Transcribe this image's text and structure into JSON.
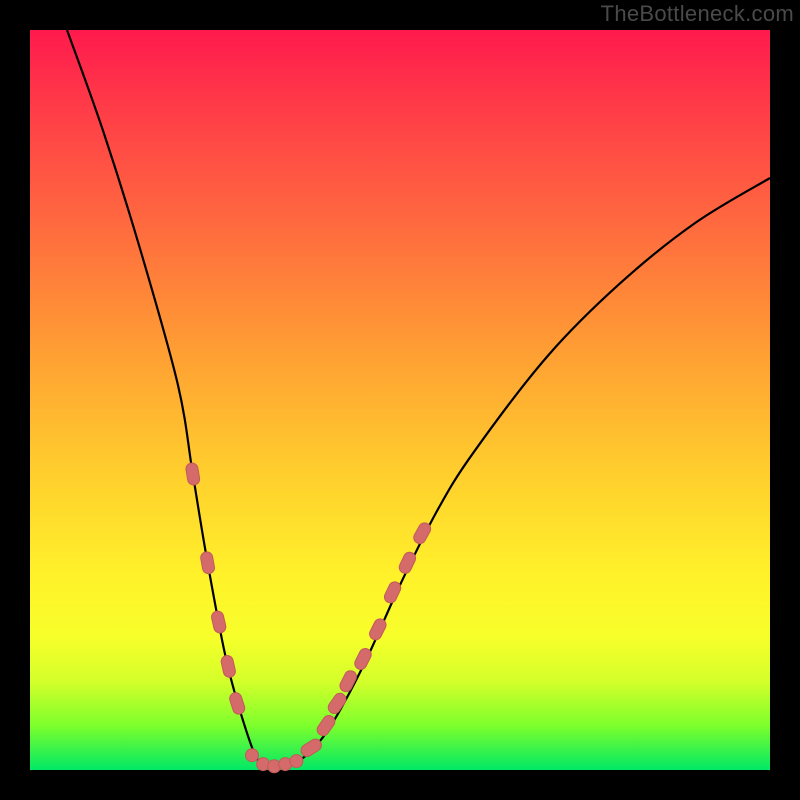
{
  "watermark": "TheBottleneck.com",
  "colors": {
    "marker_fill": "#d46a6a",
    "marker_stroke": "#c25a5a",
    "curve_stroke": "#000000",
    "frame": "#000000"
  },
  "chart_data": {
    "type": "line",
    "title": "",
    "xlabel": "",
    "ylabel": "",
    "xlim": [
      0,
      100
    ],
    "ylim": [
      0,
      100
    ],
    "series": [
      {
        "name": "bottleneck-curve",
        "x": [
          5,
          10,
          15,
          20,
          22,
          24,
          26.5,
          29,
          31,
          33,
          36,
          40,
          45,
          50,
          55,
          60,
          70,
          80,
          90,
          100
        ],
        "y": [
          100,
          86,
          70,
          52,
          40,
          28,
          15,
          6,
          1,
          0.5,
          1,
          5,
          14,
          25,
          35,
          43,
          56,
          66,
          74,
          80
        ]
      }
    ],
    "annotations": [
      {
        "name": "marker-seg-left-1",
        "x": 22,
        "y": 40,
        "kind": "pill"
      },
      {
        "name": "marker-seg-left-2",
        "x": 24,
        "y": 28,
        "kind": "pill"
      },
      {
        "name": "marker-seg-left-3",
        "x": 25.5,
        "y": 20,
        "kind": "pill"
      },
      {
        "name": "marker-seg-left-4",
        "x": 26.8,
        "y": 14,
        "kind": "pill"
      },
      {
        "name": "marker-seg-left-5",
        "x": 28,
        "y": 9,
        "kind": "pill"
      },
      {
        "name": "marker-floor-1",
        "x": 30,
        "y": 2,
        "kind": "dot"
      },
      {
        "name": "marker-floor-2",
        "x": 31.5,
        "y": 0.8,
        "kind": "dot"
      },
      {
        "name": "marker-floor-3",
        "x": 33,
        "y": 0.5,
        "kind": "dot"
      },
      {
        "name": "marker-floor-4",
        "x": 34.5,
        "y": 0.8,
        "kind": "dot"
      },
      {
        "name": "marker-floor-5",
        "x": 36,
        "y": 1.2,
        "kind": "dot"
      },
      {
        "name": "marker-seg-right-1",
        "x": 38,
        "y": 3,
        "kind": "pill"
      },
      {
        "name": "marker-seg-right-2",
        "x": 40,
        "y": 6,
        "kind": "pill"
      },
      {
        "name": "marker-seg-right-3",
        "x": 41.5,
        "y": 9,
        "kind": "pill"
      },
      {
        "name": "marker-seg-right-4",
        "x": 43,
        "y": 12,
        "kind": "pill"
      },
      {
        "name": "marker-seg-right-5",
        "x": 45,
        "y": 15,
        "kind": "pill"
      },
      {
        "name": "marker-seg-right-6",
        "x": 47,
        "y": 19,
        "kind": "pill"
      },
      {
        "name": "marker-seg-right-7",
        "x": 49,
        "y": 24,
        "kind": "pill"
      },
      {
        "name": "marker-seg-right-8",
        "x": 51,
        "y": 28,
        "kind": "pill"
      },
      {
        "name": "marker-seg-right-9",
        "x": 53,
        "y": 32,
        "kind": "pill"
      }
    ]
  }
}
